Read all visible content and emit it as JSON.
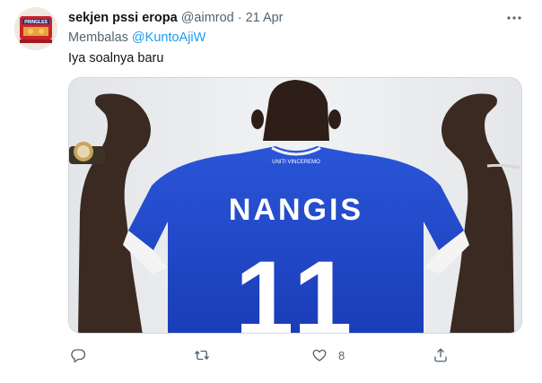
{
  "author": {
    "display_name": "sekjen pssi eropa",
    "handle": "@aimrod",
    "separator": "·",
    "date": "21 Apr",
    "avatar_text": "PRINGLES"
  },
  "reply": {
    "prefix": "Membalas",
    "to": "@KuntoAjiW"
  },
  "tweet": {
    "text": "Iya soalnya baru"
  },
  "media": {
    "jersey_name": "NANGIS",
    "jersey_number": "11",
    "collar_text": "UNITI VINCEREMO"
  },
  "actions": {
    "reply_count": "",
    "retweet_count": "",
    "like_count": "8"
  },
  "colors": {
    "link": "#1d9bf0",
    "secondary_text": "#536471",
    "jersey_blue": "#1f47c9"
  },
  "icons": [
    "more-icon",
    "reply-icon",
    "retweet-icon",
    "like-icon",
    "share-icon"
  ]
}
